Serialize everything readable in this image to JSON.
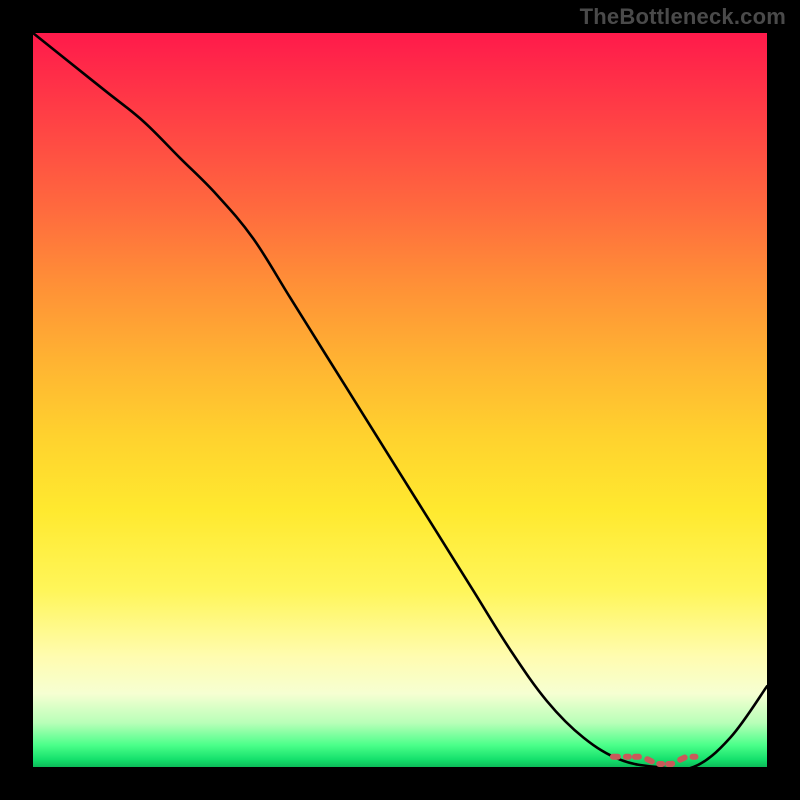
{
  "watermark": "TheBottleneck.com",
  "chart_data": {
    "type": "line",
    "title": "",
    "xlabel": "",
    "ylabel": "",
    "xlim": [
      0,
      100
    ],
    "ylim": [
      0,
      100
    ],
    "series": [
      {
        "name": "curve",
        "x": [
          0,
          5,
          10,
          15,
          20,
          25,
          30,
          35,
          40,
          45,
          50,
          55,
          60,
          65,
          70,
          75,
          80,
          85,
          90,
          95,
          100
        ],
        "values": [
          100,
          96,
          92,
          88,
          83,
          78,
          72,
          64,
          56,
          48,
          40,
          32,
          24,
          16,
          9,
          4,
          1,
          0,
          0,
          4,
          11
        ]
      },
      {
        "name": "trough-marker",
        "x": [
          79,
          81,
          83,
          85,
          87,
          89,
          91
        ],
        "values": [
          1,
          1,
          1,
          0,
          0,
          1,
          1
        ]
      }
    ],
    "gradient_stops": [
      {
        "pos": 0,
        "color": "#ff1a4b"
      },
      {
        "pos": 24,
        "color": "#ff6a3e"
      },
      {
        "pos": 55,
        "color": "#ffd22e"
      },
      {
        "pos": 85,
        "color": "#fffcb0"
      },
      {
        "pos": 97,
        "color": "#4cff8a"
      },
      {
        "pos": 100,
        "color": "#0dbb59"
      }
    ]
  }
}
